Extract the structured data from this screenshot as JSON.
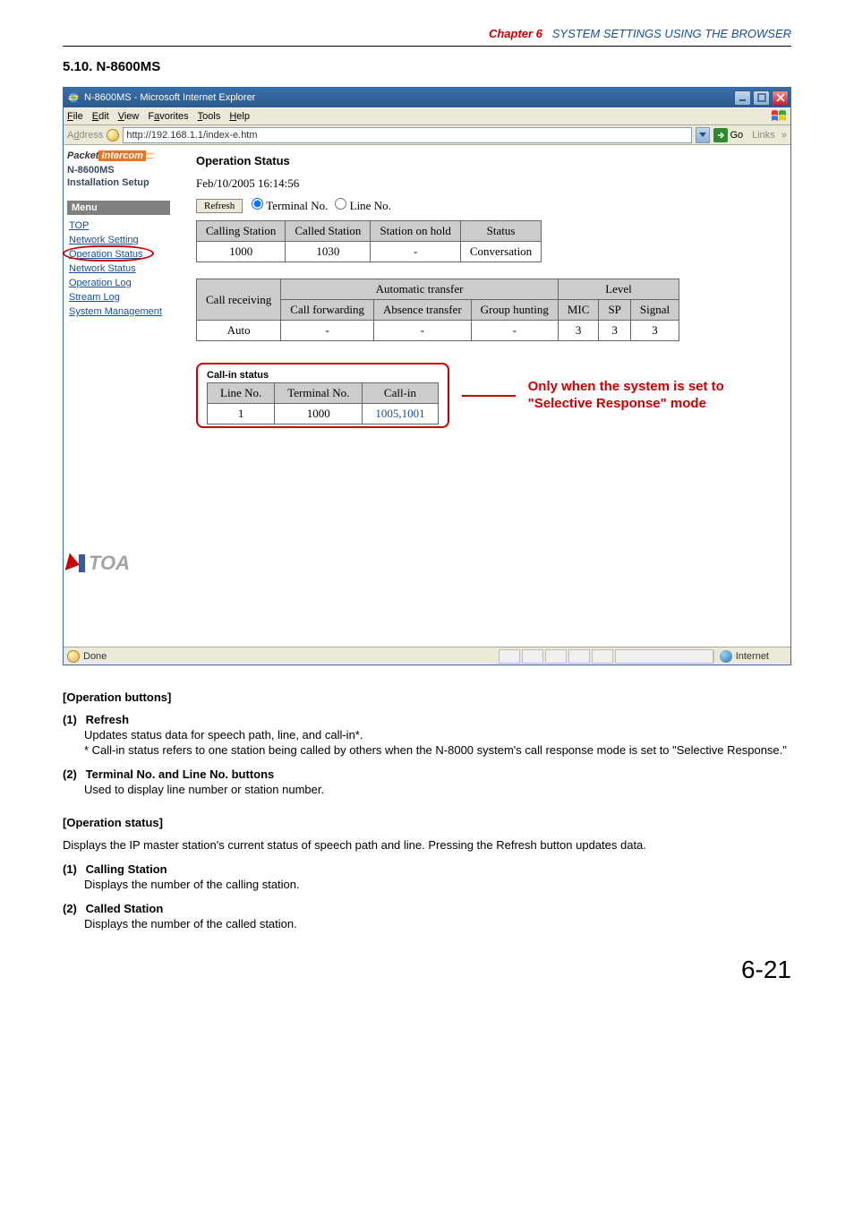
{
  "chapter": {
    "label": "Chapter 6",
    "title": "SYSTEM SETTINGS USING THE BROWSER"
  },
  "section": {
    "number": "5.10.",
    "name": "N-8600MS"
  },
  "ie": {
    "title": "N-8600MS - Microsoft Internet Explorer",
    "menus": {
      "file": "File",
      "edit": "Edit",
      "view": "View",
      "favorites": "Favorites",
      "tools": "Tools",
      "help": "Help"
    },
    "address_label": "Address",
    "url": "http://192.168.1.1/index-e.htm",
    "go_label": "Go",
    "links_label": "Links",
    "status_done": "Done",
    "status_zone": "Internet"
  },
  "sidebar": {
    "brand_a": "Packet",
    "brand_b": "Intercom",
    "model": "N-8600MS",
    "setup": "Installation Setup",
    "menu_label": "Menu",
    "items": {
      "top": "TOP",
      "network": "Network Setting",
      "operation": "Operation Status",
      "netstatus": "Network Status",
      "oplog": "Operation Log",
      "streamlog": "Stream Log",
      "sysman": "System Management"
    },
    "toa": "TOA"
  },
  "content": {
    "heading": "Operation Status",
    "timestamp": "Feb/10/2005 16:14:56",
    "refresh": "Refresh",
    "radio_terminal": "Terminal No.",
    "radio_line": "Line No.",
    "table1": {
      "headers": {
        "calling": "Calling Station",
        "called": "Called Station",
        "hold": "Station on hold",
        "status": "Status"
      },
      "row": {
        "calling": "1000",
        "called": "1030",
        "hold": "-",
        "status": "Conversation"
      }
    },
    "table2": {
      "call_recv": "Call receiving",
      "auto_group": "Automatic transfer",
      "level_group": "Level",
      "cols": {
        "cf": "Call forwarding",
        "ab": "Absence transfer",
        "gh": "Group hunting",
        "mic": "MIC",
        "sp": "SP",
        "sig": "Signal"
      },
      "row": {
        "recv": "Auto",
        "cf": "-",
        "ab": "-",
        "gh": "-",
        "mic": "3",
        "sp": "3",
        "sig": "3"
      }
    },
    "callin": {
      "title": "Call-in status",
      "headers": {
        "line": "Line No.",
        "term": "Terminal No.",
        "callin": "Call-in"
      },
      "row": {
        "line": "1",
        "term": "1000",
        "callin": "1005,1001"
      }
    },
    "annotation_l1": "Only when the system is set to",
    "annotation_l2": "\"Selective Response\" mode"
  },
  "doc": {
    "h_opbtn": "[Operation buttons]",
    "i1_num": "(1)",
    "i1_title": "Refresh",
    "i1_text": "Updates status data for speech path, line, and call-in*.",
    "i1_star": "* Call-in status refers to one station being called by others when the N-8000 system's call response mode is set to \"Selective Response.\"",
    "i2_num": "(2)",
    "i2_title": "Terminal No. and Line No. buttons",
    "i2_text": "Used to display line number or station number.",
    "h_opstat": "[Operation status]",
    "opstat_text": "Displays the IP master station's current status of speech path and line. Pressing the Refresh button updates data.",
    "s1_num": "(1)",
    "s1_title": "Calling Station",
    "s1_text": "Displays the number of the calling station.",
    "s2_num": "(2)",
    "s2_title": "Called Station",
    "s2_text": "Displays the number of the called station."
  },
  "pagenum": "6-21"
}
